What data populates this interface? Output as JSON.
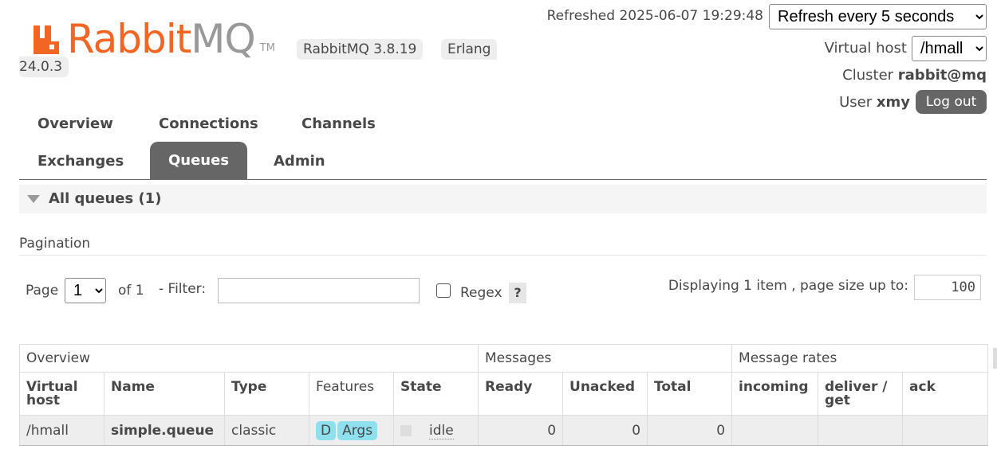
{
  "header": {
    "logo_part1": "Rabbit",
    "logo_part2": "MQ",
    "logo_tm": "TM",
    "version": "RabbitMQ 3.8.19",
    "erlang_label": "Erlang",
    "erlang_version": "24.0.3",
    "refreshed": "Refreshed 2025-06-07 19:29:48",
    "refresh_select": "Refresh every 5 seconds",
    "vhost_label": "Virtual host",
    "vhost_value": "/hmall",
    "cluster_label": "Cluster",
    "cluster_value": "rabbit@mq",
    "user_label": "User",
    "user_value": "xmy",
    "logout_label": "Log out"
  },
  "nav": {
    "tabs": [
      "Overview",
      "Connections",
      "Channels",
      "Exchanges",
      "Queues",
      "Admin"
    ],
    "active": "Queues"
  },
  "section": {
    "title": "All queues (1)"
  },
  "pagination": {
    "label": "Pagination",
    "page_label": "Page",
    "page_value": "1",
    "of_label": "of 1",
    "filter_label": "- Filter:",
    "filter_value": "",
    "regex_label": "Regex",
    "help_label": "?",
    "displaying": "Displaying 1 item , page size up to:",
    "page_size": "100"
  },
  "table": {
    "groups": [
      "Overview",
      "Messages",
      "Message rates"
    ],
    "columns": [
      "Virtual host",
      "Name",
      "Type",
      "Features",
      "State",
      "Ready",
      "Unacked",
      "Total",
      "incoming",
      "deliver / get",
      "ack"
    ],
    "rows": [
      {
        "vhost": "/hmall",
        "name": "simple.queue",
        "type": "classic",
        "features": [
          "D",
          "Args"
        ],
        "state": "idle",
        "ready": "0",
        "unacked": "0",
        "total": "0",
        "incoming": "",
        "deliver_get": "",
        "ack": ""
      }
    ]
  },
  "colors": {
    "brand_orange": "#f26522",
    "active_tab": "#666666",
    "feature_pill": "#8ee0ef"
  }
}
